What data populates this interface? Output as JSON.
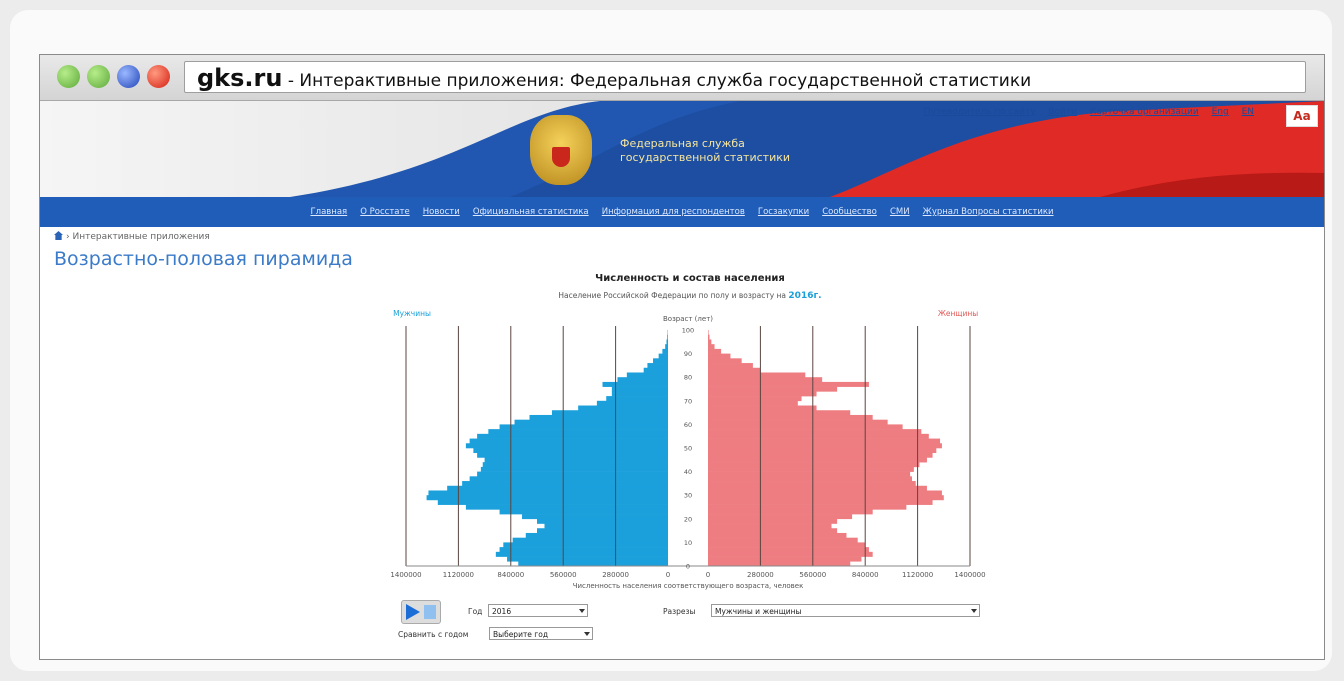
{
  "browser": {
    "url_domain": "gks.ru",
    "url_rest": " - Интерактивные приложения: Федеральная служба государственной статистики"
  },
  "header": {
    "title_line1": "Федеральная служба",
    "title_line2": "государственной статистики",
    "top_links": [
      "Путеводитель по сайту",
      "Войти",
      "Карточка организации",
      "Eng",
      "EN"
    ],
    "font_button": "Aa"
  },
  "nav": {
    "items": [
      "Главная",
      "О Росстате",
      "Новости",
      "Официальная статистика",
      "Информация для респондентов",
      "Госзакупки",
      "Сообщество",
      "СМИ",
      "Журнал Вопросы статистики"
    ]
  },
  "breadcrumb": "› Интерактивные приложения",
  "page_title": "Возрастно-половая пирамида",
  "chart_data": {
    "type": "bar",
    "title": "Численность и состав населения",
    "subtitle": "Население Российской Федерации по полу и возрасту на",
    "year": "2016г.",
    "legend_left": "Мужчины",
    "legend_right": "Женщины",
    "ylabel": "Возраст (лет)",
    "xlabel": "Численность населения соответствующего возраста, человек",
    "xlim": [
      0,
      1400000
    ],
    "x_ticks_left": [
      "1400000",
      "1120000",
      "840000",
      "560000",
      "280000",
      "0"
    ],
    "x_ticks_right": [
      "0",
      "280000",
      "560000",
      "840000",
      "1120000",
      "1400000"
    ],
    "age_ticks": [
      "100",
      "90",
      "80",
      "70",
      "60",
      "50",
      "40",
      "30",
      "20",
      "10",
      "0"
    ],
    "ages": [
      0,
      2,
      4,
      6,
      8,
      10,
      12,
      14,
      16,
      18,
      20,
      22,
      24,
      26,
      28,
      30,
      32,
      34,
      36,
      38,
      40,
      42,
      44,
      46,
      48,
      50,
      52,
      54,
      56,
      58,
      60,
      62,
      64,
      66,
      68,
      70,
      72,
      74,
      76,
      78,
      80,
      82,
      84,
      86,
      88,
      90,
      92,
      94,
      96,
      98,
      100
    ],
    "series": [
      {
        "name": "Мужчины",
        "color": "#1ba0dc",
        "values": [
          800000,
          860000,
          920000,
          900000,
          880000,
          830000,
          760000,
          700000,
          660000,
          700000,
          780000,
          900000,
          1080000,
          1230000,
          1290000,
          1280000,
          1180000,
          1100000,
          1060000,
          1020000,
          1000000,
          990000,
          980000,
          1020000,
          1040000,
          1080000,
          1060000,
          1020000,
          960000,
          900000,
          820000,
          740000,
          620000,
          480000,
          380000,
          330000,
          300000,
          300000,
          350000,
          270000,
          220000,
          130000,
          110000,
          80000,
          50000,
          30000,
          15000,
          8000,
          4000,
          2000,
          800
        ]
      },
      {
        "name": "Женщины",
        "color": "#ee7d82",
        "values": [
          760000,
          820000,
          880000,
          860000,
          840000,
          800000,
          740000,
          690000,
          660000,
          690000,
          770000,
          880000,
          1060000,
          1200000,
          1260000,
          1250000,
          1170000,
          1110000,
          1090000,
          1080000,
          1100000,
          1130000,
          1170000,
          1200000,
          1220000,
          1250000,
          1240000,
          1180000,
          1140000,
          1040000,
          960000,
          880000,
          760000,
          580000,
          480000,
          500000,
          580000,
          690000,
          860000,
          610000,
          520000,
          280000,
          240000,
          180000,
          120000,
          70000,
          35000,
          18000,
          8000,
          3000,
          1200
        ]
      }
    ]
  },
  "controls": {
    "year_label": "Год",
    "year_value": "2016",
    "compare_label": "Сравнить с годом",
    "compare_value": "Выберите год",
    "type_label": "Разрезы",
    "type_value": "Мужчины и женщины"
  }
}
